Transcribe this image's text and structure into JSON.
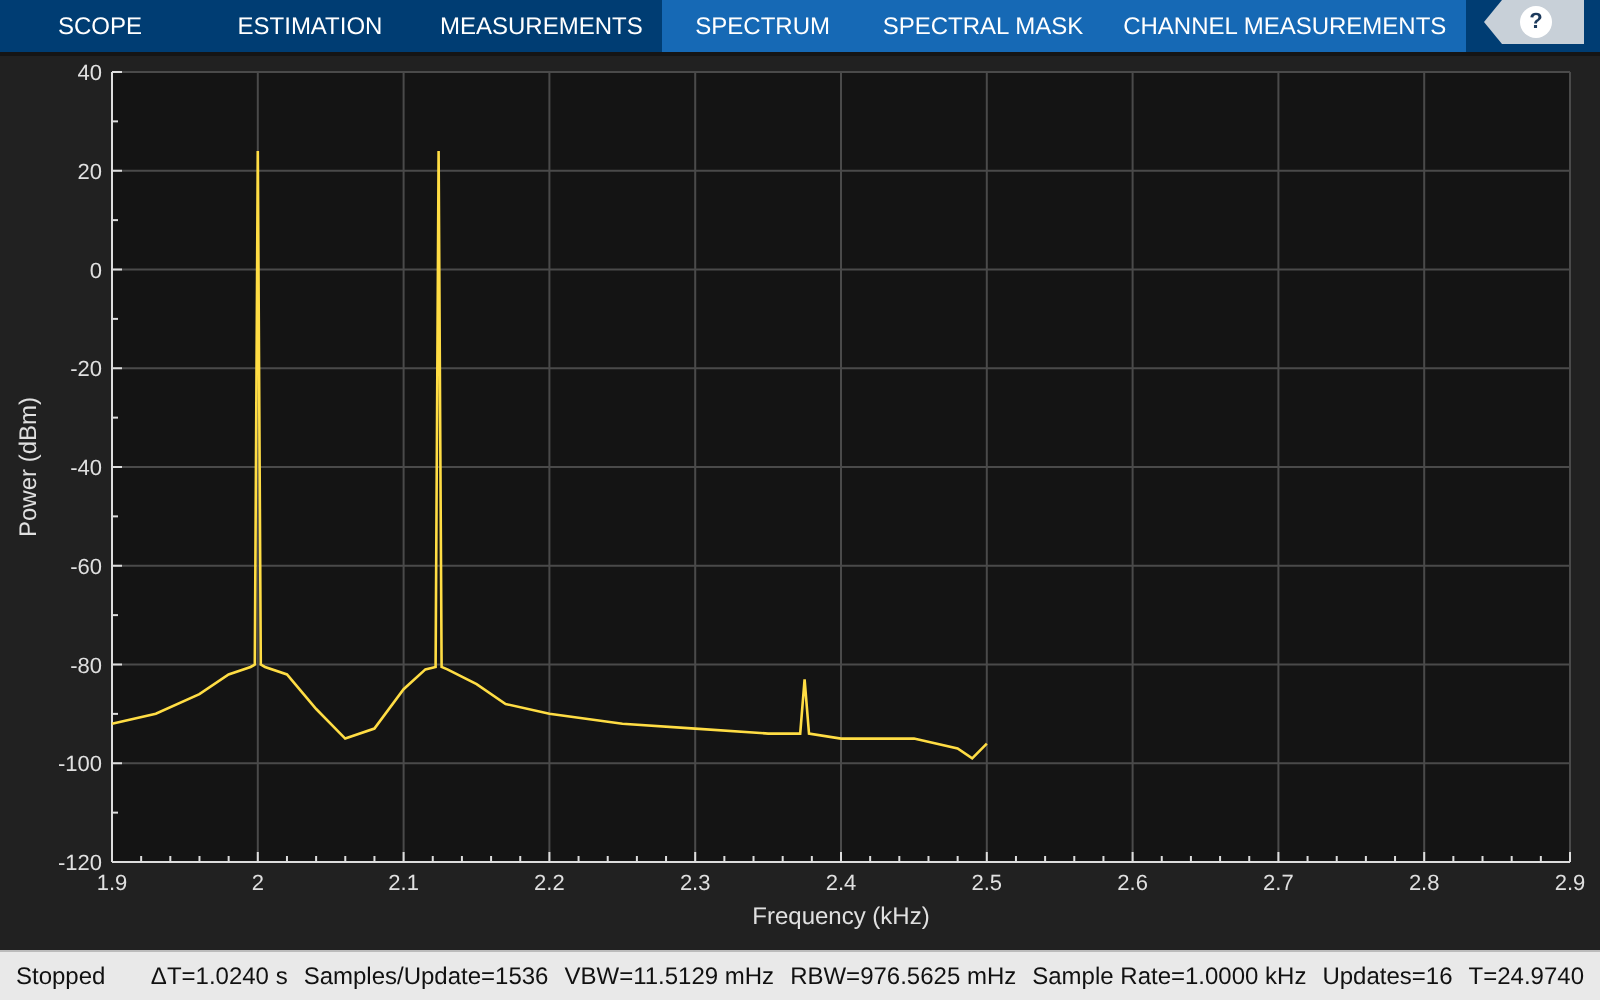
{
  "toolstrip_tabs": [
    {
      "label": "SCOPE",
      "selected": false
    },
    {
      "label": "ESTIMATION",
      "selected": false
    },
    {
      "label": "MEASUREMENTS",
      "selected": false
    },
    {
      "label": "SPECTRUM",
      "selected": true
    },
    {
      "label": "SPECTRAL MASK",
      "selected": true
    },
    {
      "label": "CHANNEL MEASUREMENTS",
      "selected": true
    }
  ],
  "help_button": "?",
  "plot": {
    "chart_data": {
      "type": "line",
      "xlabel": "Frequency (kHz)",
      "ylabel": "Power (dBm)",
      "xlim": [
        1.9,
        2.9
      ],
      "ylim": [
        -120,
        40
      ],
      "xticks": [
        1.9,
        2,
        2.1,
        2.2,
        2.3,
        2.4,
        2.5,
        2.6,
        2.7,
        2.8,
        2.9
      ],
      "yticks": [
        -120,
        -100,
        -80,
        -60,
        -40,
        -20,
        0,
        20,
        40
      ],
      "x": [
        1.9,
        1.93,
        1.96,
        1.98,
        1.995,
        1.998,
        2.0,
        2.002,
        2.005,
        2.02,
        2.04,
        2.06,
        2.08,
        2.1,
        2.115,
        2.122,
        2.124,
        2.126,
        2.13,
        2.15,
        2.17,
        2.2,
        2.25,
        2.3,
        2.35,
        2.372,
        2.375,
        2.378,
        2.4,
        2.45,
        2.48,
        2.49,
        2.5
      ],
      "grid": true,
      "series": [
        {
          "color": "#ffdd44",
          "values": [
            -92,
            -90,
            -86,
            -82,
            -80.5,
            -80,
            24,
            -80,
            -80.5,
            -82,
            -89,
            -95,
            -93,
            -85,
            -81,
            -80.5,
            24,
            -80.5,
            -81,
            -84,
            -88,
            -90,
            -92,
            -93,
            -94,
            -94,
            -83,
            -94,
            -95,
            -95,
            -97,
            -99,
            -96
          ]
        }
      ]
    }
  },
  "status_bar": {
    "state": "Stopped",
    "fields": [
      "ΔT=1.0240 s",
      "Samples/Update=1536",
      "VBW=11.5129 mHz",
      "RBW=976.5625 mHz",
      "Sample Rate=1.0000 kHz",
      "Updates=16",
      "T=24.9740"
    ]
  }
}
